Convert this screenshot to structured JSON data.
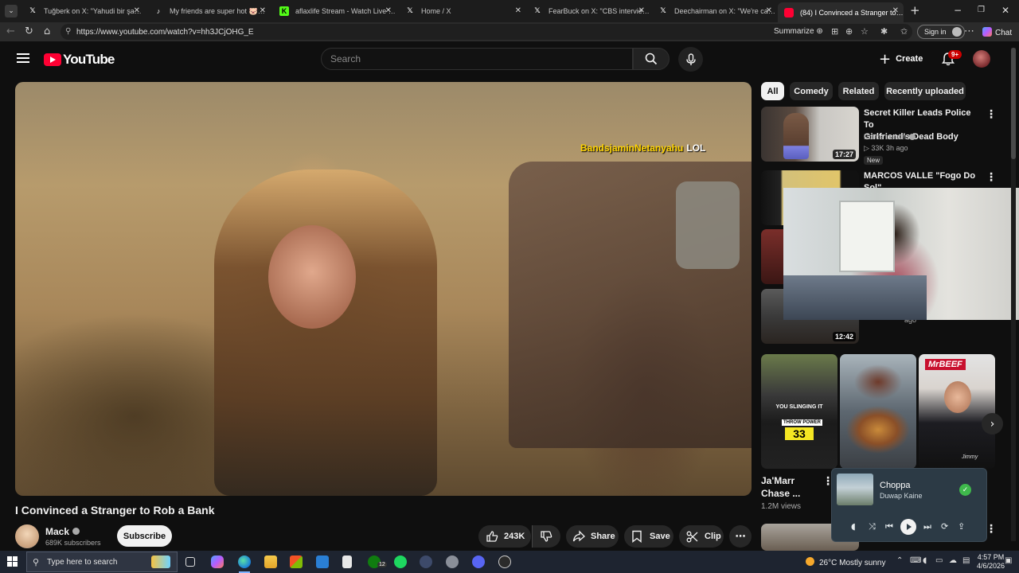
{
  "browser": {
    "tabs": [
      {
        "title": "Tuğberk on X: \"Yahudi bir şahıs, k",
        "icon": "x-icon"
      },
      {
        "title": "My friends are super hot 🐷😊 #",
        "icon": "tiktok-icon"
      },
      {
        "title": "aflaxlife Stream - Watch Live on K",
        "icon": "kick-icon"
      },
      {
        "title": "Home / X",
        "icon": "x-icon"
      },
      {
        "title": "FearBuck on X: \"CBS interviewed a",
        "icon": "x-icon"
      },
      {
        "title": "Deechairman on X: \"We're cancel",
        "icon": "x-icon"
      },
      {
        "title": "(84) I Convinced a Stranger to Rob",
        "icon": "youtube-icon"
      }
    ],
    "url": "https://www.youtube.com/watch?v=hh3JCjOHG_E",
    "summarize_label": "Summarize",
    "signin_label": "Sign in",
    "chat_label": "Chat"
  },
  "youtube": {
    "logo_text": "YouTube",
    "search_placeholder": "Search",
    "create_label": "Create",
    "notification_count": "9+"
  },
  "video": {
    "overlay_handle": "BandsjaminNetanyahu",
    "overlay_suffix": "LOL",
    "title": "I Convinced a Stranger to Rob a Bank",
    "channel": "Mack",
    "subscribers": "689K subscribers",
    "subscribe_label": "Subscribe",
    "likes": "243K",
    "share_label": "Share",
    "save_label": "Save",
    "clip_label": "Clip"
  },
  "chips": [
    "All",
    "Comedy",
    "Related",
    "Recently uploaded"
  ],
  "recommendations": [
    {
      "title_line1": "Secret Killer Leads Police To",
      "title_line2": "Girlfriend's Dead Body",
      "channel": "Police Insider",
      "meta": "▷ 33K  3h ago",
      "badge": "New",
      "duration": "17:27"
    },
    {
      "title_line1": "MARCOS VALLE \"Fogo Do Sol\"",
      "channel": "",
      "meta": "",
      "duration": ""
    },
    {
      "meta": "ago",
      "duration": "12:42"
    }
  ],
  "shorts": [
    {
      "title_line1": "Ja'Marr",
      "title_line2": "Chase ...",
      "views": "1.2M views",
      "thumb_text_1": "YOU SLINGING IT",
      "thumb_text_2": "THROW POWER",
      "thumb_text_3": "33"
    },
    {
      "title_line1": ""
    },
    {
      "title_line1": "",
      "thumb_text": "MrBEEF",
      "thumb_sig": "Jimmy"
    }
  ],
  "media_player": {
    "song": "Choppa",
    "artist": "Duwap Kaine"
  },
  "taskbar": {
    "search_placeholder": "Type here to search",
    "weather": "26°C  Mostly sunny",
    "time": "4:57 PM",
    "date": "4/6/2026",
    "xbox_badge": "12"
  },
  "colors": {
    "youtube_red": "#ff0033",
    "background": "#0f0f0f",
    "chip_bg": "#272727",
    "overlay_text": "#ffd400"
  }
}
